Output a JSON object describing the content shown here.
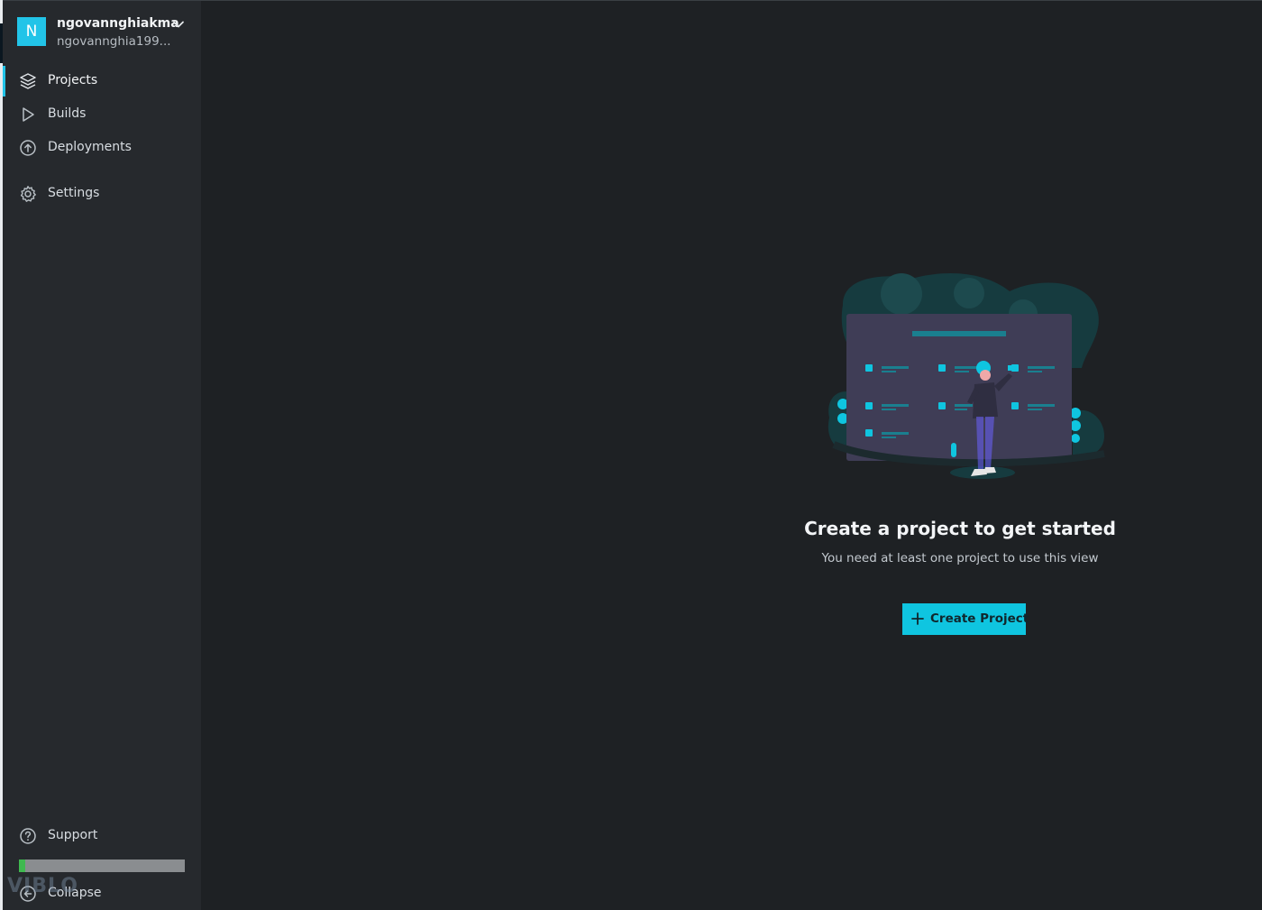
{
  "account": {
    "avatar_letter": "N",
    "name": "ngovannghiakma",
    "email": "ngovannghia199..."
  },
  "nav": {
    "projects": "Projects",
    "builds": "Builds",
    "deployments": "Deployments",
    "settings": "Settings",
    "support": "Support",
    "collapse": "Collapse"
  },
  "usage": {
    "fraction": 0.04
  },
  "watermark": "VIBLO",
  "empty_state": {
    "title": "Create a project to get started",
    "subtitle": "You need at least one project to use this view",
    "button_label": "Create Project"
  },
  "colors": {
    "accent": "#22c4e8",
    "button": "#0fc5e0",
    "sidebar_bg": "#26292d",
    "main_bg": "#1e2124",
    "usage_fill": "#3fb950"
  },
  "icons": {
    "projects": "layers-icon",
    "builds": "play-icon",
    "deployments": "upload-circle-icon",
    "settings": "gear-icon",
    "support": "help-circle-icon",
    "collapse": "arrow-left-circle-icon",
    "account_menu": "chevron-down-icon",
    "create": "plus-icon"
  }
}
